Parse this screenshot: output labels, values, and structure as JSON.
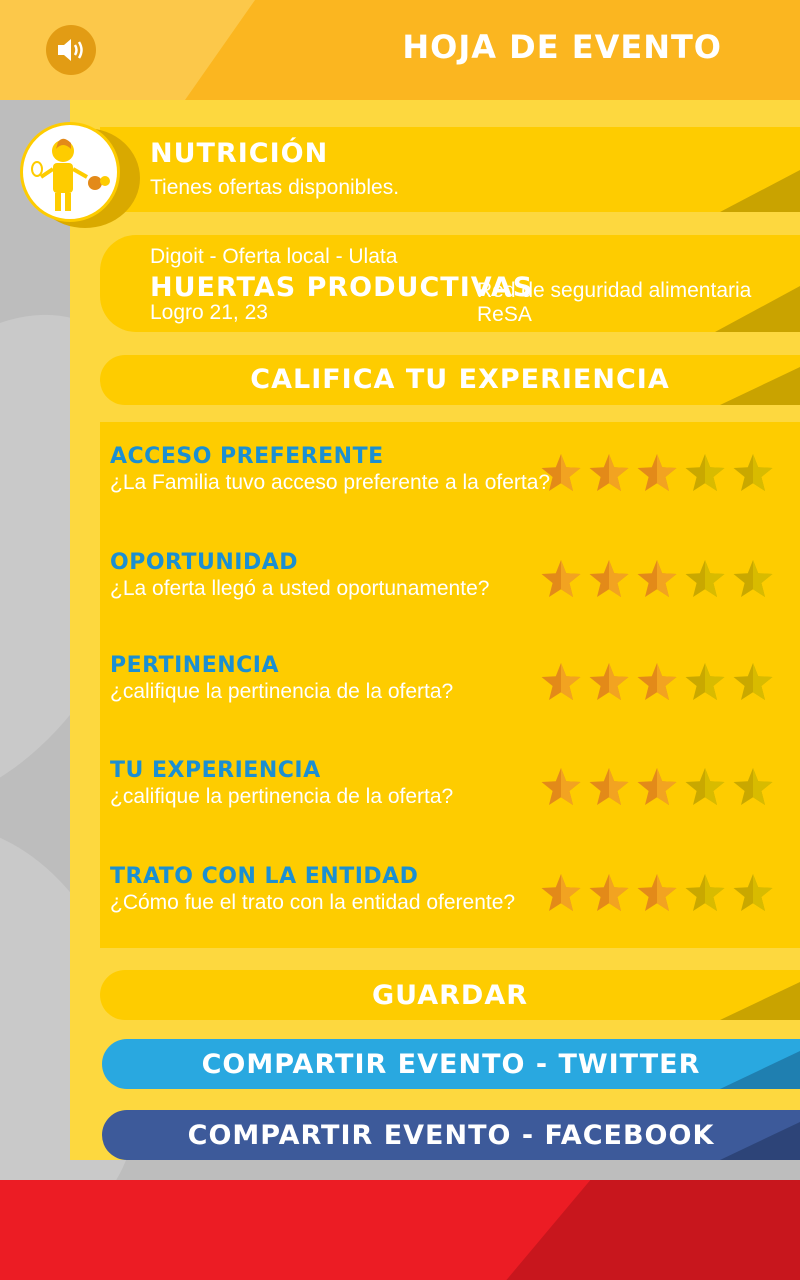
{
  "header": {
    "title": "HOJA DE EVENTO",
    "sound_icon": "speaker-icon"
  },
  "category": {
    "title": "NUTRICIÓN",
    "subtitle": "Tienes  ofertas disponibles."
  },
  "offer": {
    "line1": "Digoit - Oferta local - Ulata",
    "name": "HUERTAS PRODUCTIVAS",
    "network": "Red de seguridad alimentaria ReSA",
    "achievement": "Logro 21, 23"
  },
  "rate_title": "CALIFICA TU EXPERIENCIA",
  "ratings": [
    {
      "title": "ACCESO PREFERENTE",
      "question": "¿La Familia tuvo acceso preferente a la oferta?",
      "stars": 3,
      "max": 5
    },
    {
      "title": "OPORTUNIDAD",
      "question": "¿La oferta llegó a usted oportunamente?",
      "stars": 3,
      "max": 5
    },
    {
      "title": "PERTINENCIA",
      "question": "¿califique la pertinencia de la oferta?",
      "stars": 3,
      "max": 5
    },
    {
      "title": "TU EXPERIENCIA",
      "question": "¿califique la pertinencia de la oferta?",
      "stars": 3,
      "max": 5
    },
    {
      "title": "TRATO CON LA ENTIDAD",
      "question": "¿Cómo fue el trato con la entidad oferente?",
      "stars": 3,
      "max": 5
    }
  ],
  "buttons": {
    "save": "GUARDAR",
    "twitter": "COMPARTIR EVENTO - TWITTER",
    "facebook": "COMPARTIR EVENTO - FACEBOOK"
  },
  "colors": {
    "header": "#fbb620",
    "card": "#fecc00",
    "star_filled": "#e38a19",
    "star_empty": "#c9a800",
    "twitter": "#29a8e0",
    "facebook": "#3d5a9a",
    "footer": "#ec1c24"
  }
}
